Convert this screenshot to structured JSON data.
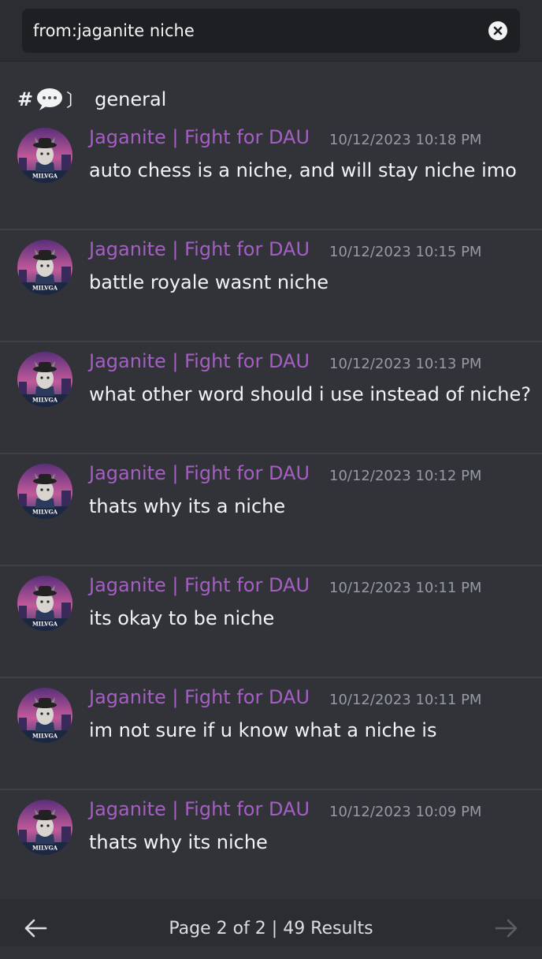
{
  "search": {
    "query": "from:jaganite niche"
  },
  "channel": {
    "hash": "#",
    "bracket": "〕",
    "name": "general"
  },
  "icons": {
    "clear": "close-circle-icon",
    "channel_emoji": "speech-bubble-icon",
    "prev": "arrow-left-icon",
    "next": "arrow-right-icon"
  },
  "colors": {
    "author": "#a55fc3",
    "background": "#313338",
    "timestamp": "#949ba4"
  },
  "messages": [
    {
      "author": "Jaganite | Fight for DAU",
      "timestamp": "10/12/2023 10:18 PM",
      "content": "auto chess is a niche, and will stay niche imo"
    },
    {
      "author": "Jaganite | Fight for DAU",
      "timestamp": "10/12/2023 10:15 PM",
      "content": "battle royale wasnt niche"
    },
    {
      "author": "Jaganite | Fight for DAU",
      "timestamp": "10/12/2023 10:13 PM",
      "content": "what other word should i use instead of niche?"
    },
    {
      "author": "Jaganite | Fight for DAU",
      "timestamp": "10/12/2023 10:12 PM",
      "content": "thats why its a niche"
    },
    {
      "author": "Jaganite | Fight for DAU",
      "timestamp": "10/12/2023 10:11 PM",
      "content": "its okay to be niche"
    },
    {
      "author": "Jaganite | Fight for DAU",
      "timestamp": "10/12/2023 10:11 PM",
      "content": "im not sure if u know what a niche is"
    },
    {
      "author": "Jaganite | Fight for DAU",
      "timestamp": "10/12/2023 10:09 PM",
      "content": "thats why its niche"
    }
  ],
  "avatar_label": "MILVGA",
  "pager": {
    "text": "Page 2 of 2  |  49 Results"
  }
}
